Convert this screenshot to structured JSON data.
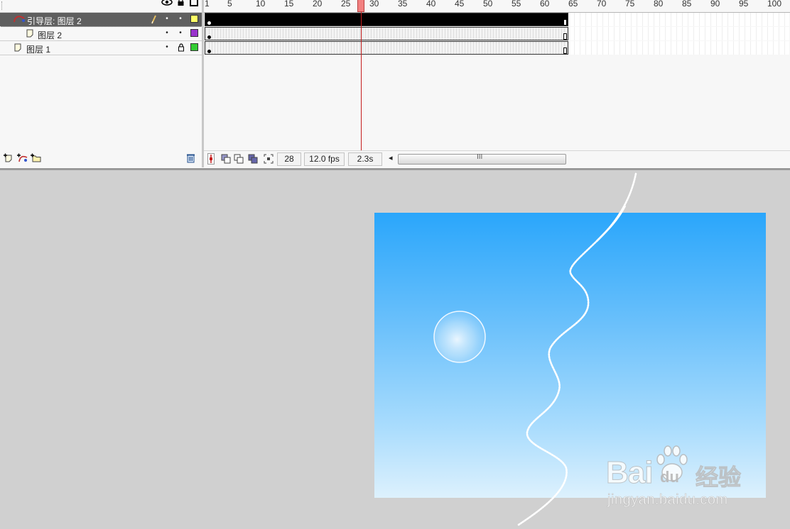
{
  "header_icons": [
    "eye-icon",
    "lock-icon",
    "outline-icon"
  ],
  "layers": [
    {
      "name": "引导层: 图层 2",
      "type": "guide",
      "selected": true,
      "color": "#ffff66"
    },
    {
      "name": "图层 2",
      "type": "normal",
      "selected": false,
      "color": "#9933cc"
    },
    {
      "name": "图层 1",
      "type": "normal",
      "selected": false,
      "locked": true,
      "color": "#33cc33"
    }
  ],
  "ruler_labels": [
    "1",
    "5",
    "10",
    "15",
    "20",
    "25",
    "30",
    "35",
    "40",
    "45",
    "50",
    "55",
    "60",
    "65",
    "70",
    "75",
    "80",
    "85",
    "90",
    "95",
    "100"
  ],
  "current_frame": 28,
  "status": {
    "frame": "28",
    "fps": "12.0 fps",
    "time": "2.3s"
  },
  "scroll_handle": "III",
  "scroll_left_arrow": "◂",
  "stage": {
    "ball_color": "#ffffff",
    "bg_top": "#2aa6fb",
    "bg_bottom": "#ddf1fd"
  },
  "watermark": {
    "brand": "Bai",
    "brand_suffix": "du",
    "chinese": "经验",
    "url": "jingyan.baidu.com"
  }
}
